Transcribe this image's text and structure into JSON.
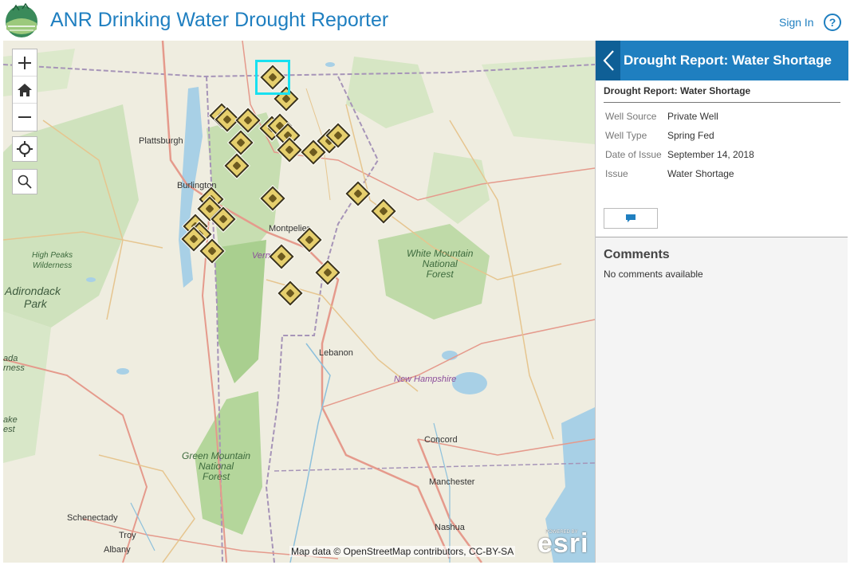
{
  "header": {
    "title": "ANR Drinking Water Drought Reporter",
    "sign_in": "Sign In",
    "help": "?"
  },
  "map": {
    "labels": {
      "plattsburgh": "Plattsburgh",
      "burlington": "Burlington",
      "montpelier": "Montpelier",
      "vermont": "Verm",
      "lebanon": "Lebanon",
      "concord": "Concord",
      "manchester": "Manchester",
      "nashua": "Nashua",
      "schenectady": "Schenectady",
      "troy": "Troy",
      "albany": "Albany",
      "adirondack_1": "Adirondack",
      "adirondack_2": "Park",
      "high_peaks_1": "High Peaks",
      "high_peaks_2": "Wilderness",
      "white_mountain_1": "White Mountain",
      "white_mountain_2": "National",
      "white_mountain_3": "Forest",
      "green_mountain_1": "Green Mountain",
      "green_mountain_2": "National",
      "green_mountain_3": "Forest",
      "new_hampshire": "New Hampshire",
      "edge_1": "ada",
      "edge_2": "rness",
      "edge_3": "ake",
      "edge_4": "est"
    },
    "attribution": "Map data © OpenStreetMap contributors, CC-BY-SA",
    "esri_logo": "esri",
    "esri_powered": "POWERED BY"
  },
  "panel": {
    "header_title": "Drought Report: Water Shortage",
    "popup_title": "Drought Report: Water Shortage",
    "attributes": [
      {
        "key": "Well Source",
        "value": "Private Well"
      },
      {
        "key": "Well Type",
        "value": "Spring Fed"
      },
      {
        "key": "Date of Issue",
        "value": "September 14, 2018"
      },
      {
        "key": "Issue",
        "value": "Water Shortage"
      }
    ],
    "comments_title": "Comments",
    "comments_empty": "No comments available"
  },
  "colors": {
    "brand_blue": "#1f7fc0",
    "dark_blue": "#0f5f96",
    "selection": "#19e0f0",
    "marker_fill": "#e6cf6d"
  }
}
